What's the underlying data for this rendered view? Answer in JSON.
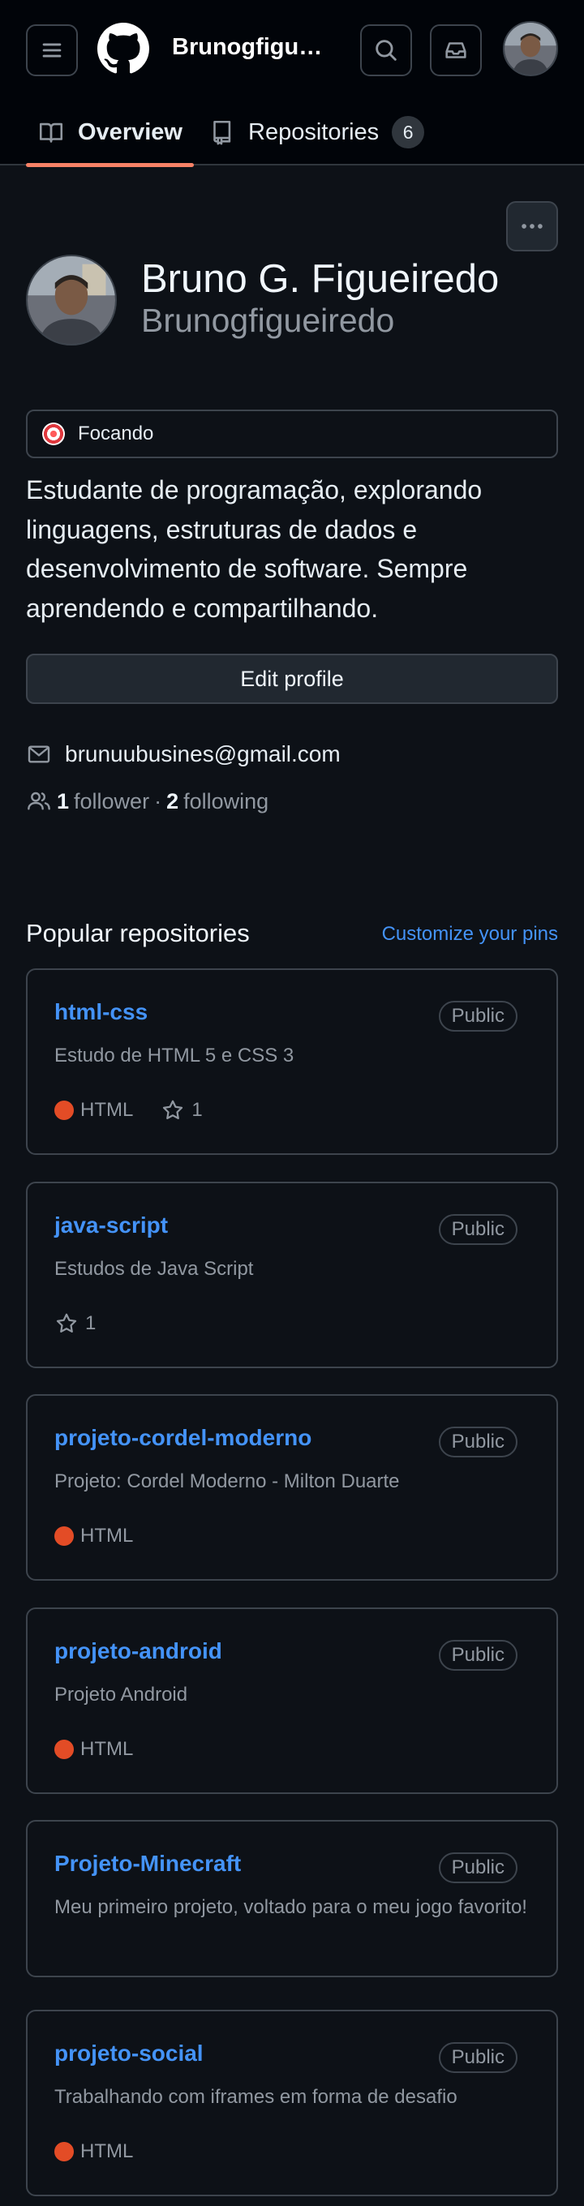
{
  "header": {
    "owner_name": "Brunogfigueiredo",
    "tabs": [
      {
        "label": "Overview"
      },
      {
        "label": "Repositories",
        "count": "6"
      }
    ]
  },
  "profile": {
    "full_name": "Bruno G. Figueiredo",
    "login": "Brunogfigueiredo",
    "status": "Focando",
    "bio": "Estudante de programação, explorando linguagens, estruturas de dados e desenvolvimento de software. Sempre aprendendo e compartilhando.",
    "edit_label": "Edit profile",
    "email": "brunuubusines@gmail.com",
    "followers_count": "1",
    "followers_label": "follower",
    "separator": "·",
    "following_count": "2",
    "following_label": "following"
  },
  "popular": {
    "title": "Popular repositories",
    "customize_label": "Customize your pins",
    "repos": [
      {
        "name": "html-css",
        "visibility": "Public",
        "description": "Estudo de HTML 5 e CSS 3",
        "language": "HTML",
        "stars": "1"
      },
      {
        "name": "java-script",
        "visibility": "Public",
        "description": "Estudos de Java Script",
        "stars": "1"
      },
      {
        "name": "projeto-cordel-moderno",
        "visibility": "Public",
        "description": "Projeto: Cordel Moderno - Milton Duarte",
        "language": "HTML"
      },
      {
        "name": "projeto-android",
        "visibility": "Public",
        "description": "Projeto Android",
        "language": "HTML"
      },
      {
        "name": "Projeto-Minecraft",
        "visibility": "Public",
        "description": "Meu primeiro projeto, voltado para o meu jogo favorito!"
      },
      {
        "name": "projeto-social",
        "visibility": "Public",
        "description": "Trabalhando com iframes em forma de desafio",
        "language": "HTML"
      }
    ]
  },
  "colors": {
    "background": "#0d1117",
    "link": "#4493f8",
    "tab_underline": "#f78166",
    "html_language": "#e34c26"
  }
}
